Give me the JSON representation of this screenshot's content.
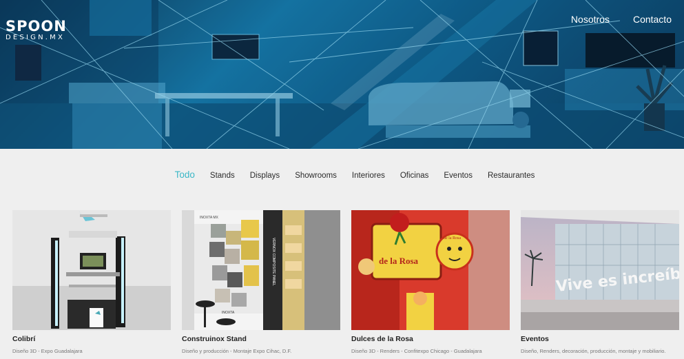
{
  "brand": {
    "logo_main": "SPOON",
    "logo_sub": "DESIGN.MX"
  },
  "nav": {
    "items": [
      "Nosotros",
      "Contacto"
    ]
  },
  "filters": {
    "active_index": 0,
    "items": [
      "Todo",
      "Stands",
      "Displays",
      "Showrooms",
      "Interiores",
      "Oficinas",
      "Eventos",
      "Restaurantes"
    ]
  },
  "projects": [
    {
      "title": "Colibrí",
      "subtitle": "Diseño 3D - Expo Guadalajara"
    },
    {
      "title": "Construinox Stand",
      "subtitle": "Diseño y producción - Montaje Expo Cihac, D.F."
    },
    {
      "title": "Dulces de la Rosa",
      "subtitle": "Diseño 3D - Renders - Confitexpo Chicago - Guadalajara"
    },
    {
      "title": "Eventos",
      "subtitle": "Diseño, Renders, decoración, producción, montaje y mobiliario."
    }
  ],
  "thumb_text": {
    "construinox_sign": "INOXTA MX",
    "construinox_panel": "VERNOX COMPOSITE PANEL",
    "construinox_brand": "INOXTA",
    "rosa_sign": "de la Rosa",
    "rosa_mascot_label": "de la Rosa",
    "eventos_sign": "Vive es increíble"
  },
  "colors": {
    "accent": "#3ab7c6",
    "hero_blue": "#1679a8",
    "background": "#efefef"
  }
}
